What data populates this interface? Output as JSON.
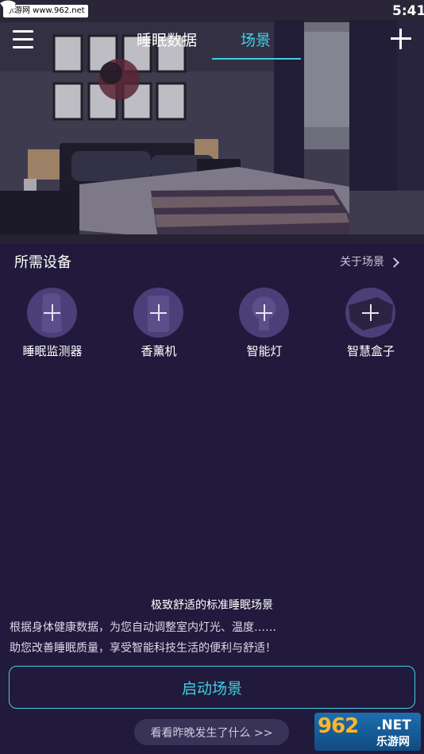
{
  "status_bar": {
    "watermark": "乐游网 www.962.net",
    "time": "5:41"
  },
  "nav": {
    "tab_sleep_data": "睡眠数据",
    "tab_scene": "场景",
    "active_tab": "场景"
  },
  "devices": {
    "title": "所需设备",
    "about_link": "关于场景",
    "items": [
      {
        "label": "睡眠监测器",
        "icon": "sleep-monitor-icon"
      },
      {
        "label": "香薰机",
        "icon": "aroma-diffuser-icon"
      },
      {
        "label": "智能灯",
        "icon": "smart-bulb-icon"
      },
      {
        "label": "智慧盒子",
        "icon": "smart-box-icon"
      }
    ]
  },
  "scene": {
    "title": "极致舒适的标准睡眠场景",
    "description_line1": "根据身体健康数据，为您自动调整室内灯光、温度……",
    "description_line2": "助您改善睡眠质量，享受智能科技生活的便利与舒适！",
    "start_button": "启动场景",
    "history_link": "看看昨晚发生了什么 >>"
  },
  "logo": {
    "number": "962",
    "suffix": ".NET",
    "cn": "乐游网"
  },
  "colors": {
    "background": "#221a3c",
    "accent": "#3fd0e0",
    "device_circle": "#4a3f78"
  }
}
